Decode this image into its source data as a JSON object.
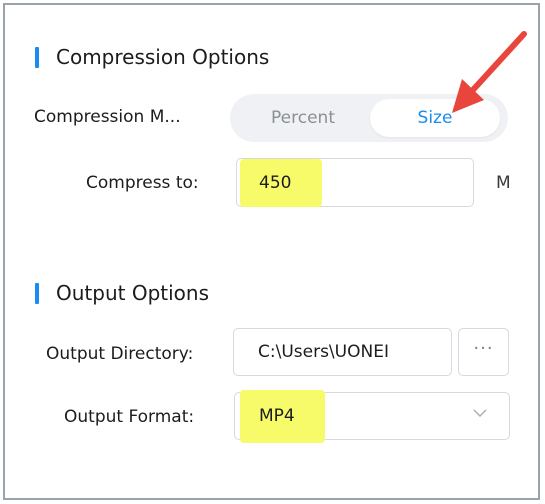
{
  "compression": {
    "title": "Compression Options",
    "mode_label": "Compression M...",
    "modes": [
      "Percent",
      "Size"
    ],
    "selected_mode": "Size",
    "compress_to_label": "Compress to:",
    "compress_to_value": "450",
    "unit": "M"
  },
  "output": {
    "title": "Output Options",
    "directory_label": "Output Directory:",
    "directory_value": "C:\\Users\\UONEI",
    "browse_label": "···",
    "format_label": "Output Format:",
    "format_value": "MP4"
  },
  "colors": {
    "accent": "#1a8cf0",
    "highlight": "#f7fb6a",
    "annotation_arrow": "#e8453c"
  },
  "icons": [
    "chevron-down-icon"
  ]
}
